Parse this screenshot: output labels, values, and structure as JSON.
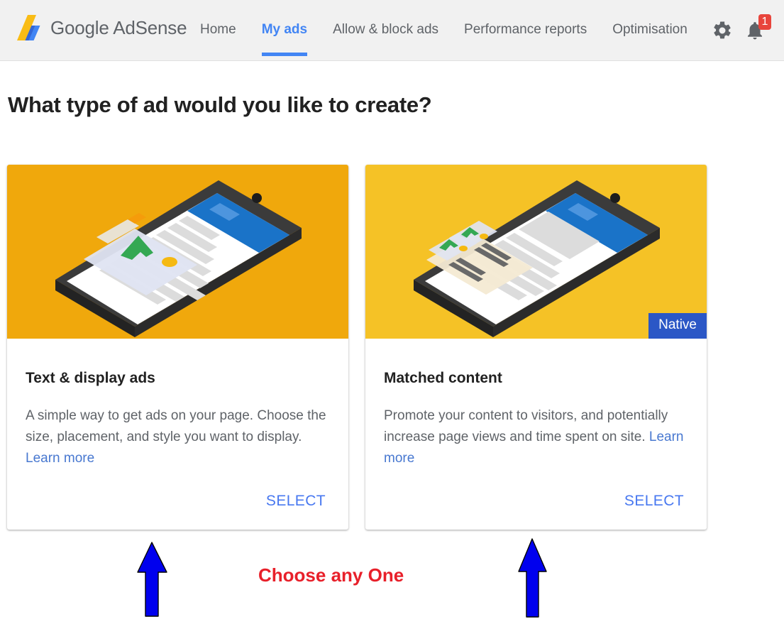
{
  "header": {
    "brand": {
      "logo_icon": "adsense-logo-icon",
      "name_bold": "Google",
      "name_light": "AdSense"
    },
    "nav": [
      {
        "label": "Home",
        "active": false
      },
      {
        "label": "My ads",
        "active": true
      },
      {
        "label": "Allow & block ads",
        "active": false
      },
      {
        "label": "Performance reports",
        "active": false
      },
      {
        "label": "Optimisation",
        "active": false
      }
    ],
    "icons": [
      {
        "name": "gear-icon",
        "label": "Settings"
      },
      {
        "name": "bell-icon",
        "label": "Notifications",
        "badge": "1"
      }
    ],
    "colors": {
      "background": "#f1f1f1",
      "active_blue": "#4285f4",
      "badge_red": "#e8453c"
    }
  },
  "main": {
    "page_title": "What type of ad would you like to create?",
    "cards": [
      {
        "title": "Text & display ads",
        "description": "A simple way to get ads on your page. Choose the size, placement, and style you want to display. ",
        "learn_more": "Learn more",
        "select_label": "SELECT",
        "badge": null,
        "art_icon": "phone-display-ad-illustration",
        "art_bg": "#f0a80c"
      },
      {
        "title": "Matched content",
        "description": "Promote your content to visitors, and potentially increase page views and time spent on site. ",
        "learn_more": "Learn more",
        "select_label": "SELECT",
        "badge": "Native",
        "art_icon": "phone-matched-content-illustration",
        "art_bg": "#f5c226"
      }
    ]
  },
  "annotations": {
    "callout_text": "Choose any One",
    "callout_color": "#e8202a",
    "arrow_color": "#0000ee",
    "arrows": [
      {
        "name": "blue-arrow-left",
        "points_to": "Text & display ads card"
      },
      {
        "name": "blue-arrow-right",
        "points_to": "Matched content card"
      }
    ]
  }
}
